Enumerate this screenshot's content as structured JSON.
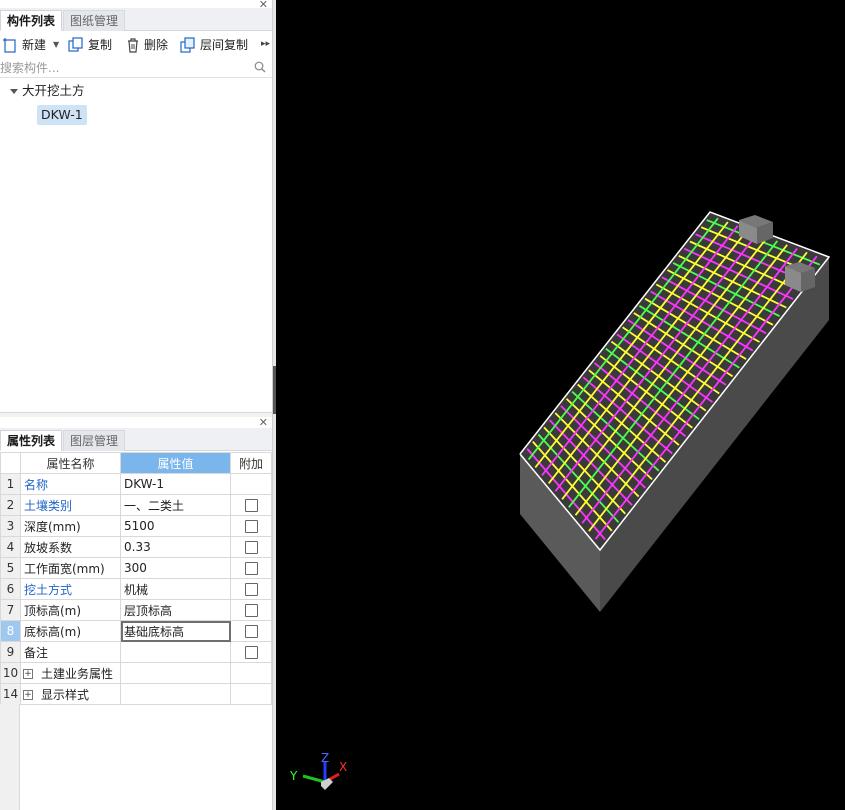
{
  "component_panel": {
    "tabs": [
      {
        "label": "构件列表"
      },
      {
        "label": "图纸管理"
      }
    ],
    "toolbar": {
      "new": "新建",
      "copy": "复制",
      "delete": "删除",
      "floor_copy": "层间复制"
    },
    "search_placeholder": "搜索构件...",
    "tree": {
      "root": "大开挖土方",
      "leaf": "DKW-1"
    }
  },
  "property_panel": {
    "tabs": [
      {
        "label": "属性列表"
      },
      {
        "label": "图层管理"
      }
    ],
    "headers": {
      "name": "属性名称",
      "value": "属性值",
      "extra": "附加"
    },
    "rows": [
      {
        "num": "1",
        "name": "名称",
        "value": "DKW-1"
      },
      {
        "num": "2",
        "name": "土壤类别",
        "value": "一、二类土"
      },
      {
        "num": "3",
        "name": "深度(mm)",
        "value": "5100"
      },
      {
        "num": "4",
        "name": "放坡系数",
        "value": "0.33"
      },
      {
        "num": "5",
        "name": "工作面宽(mm)",
        "value": "300"
      },
      {
        "num": "6",
        "name": "挖土方式",
        "value": "机械"
      },
      {
        "num": "7",
        "name": "顶标高(m)",
        "value": "层顶标高"
      },
      {
        "num": "8",
        "name": "底标高(m)",
        "value": "基础底标高"
      },
      {
        "num": "9",
        "name": "备注",
        "value": ""
      }
    ],
    "groups": [
      {
        "num": "10",
        "name": "土建业务属性"
      },
      {
        "num": "14",
        "name": "显示样式"
      }
    ]
  },
  "axis_labels": {
    "x": "X",
    "y": "Y",
    "z": "Z"
  },
  "colors": {
    "rebar_yellow": "#ffff33",
    "rebar_magenta": "#ff33ff",
    "rebar_green": "#4dff4d",
    "pit_body": "#5b5b5b",
    "selection_blue": "#7ab6ec"
  }
}
